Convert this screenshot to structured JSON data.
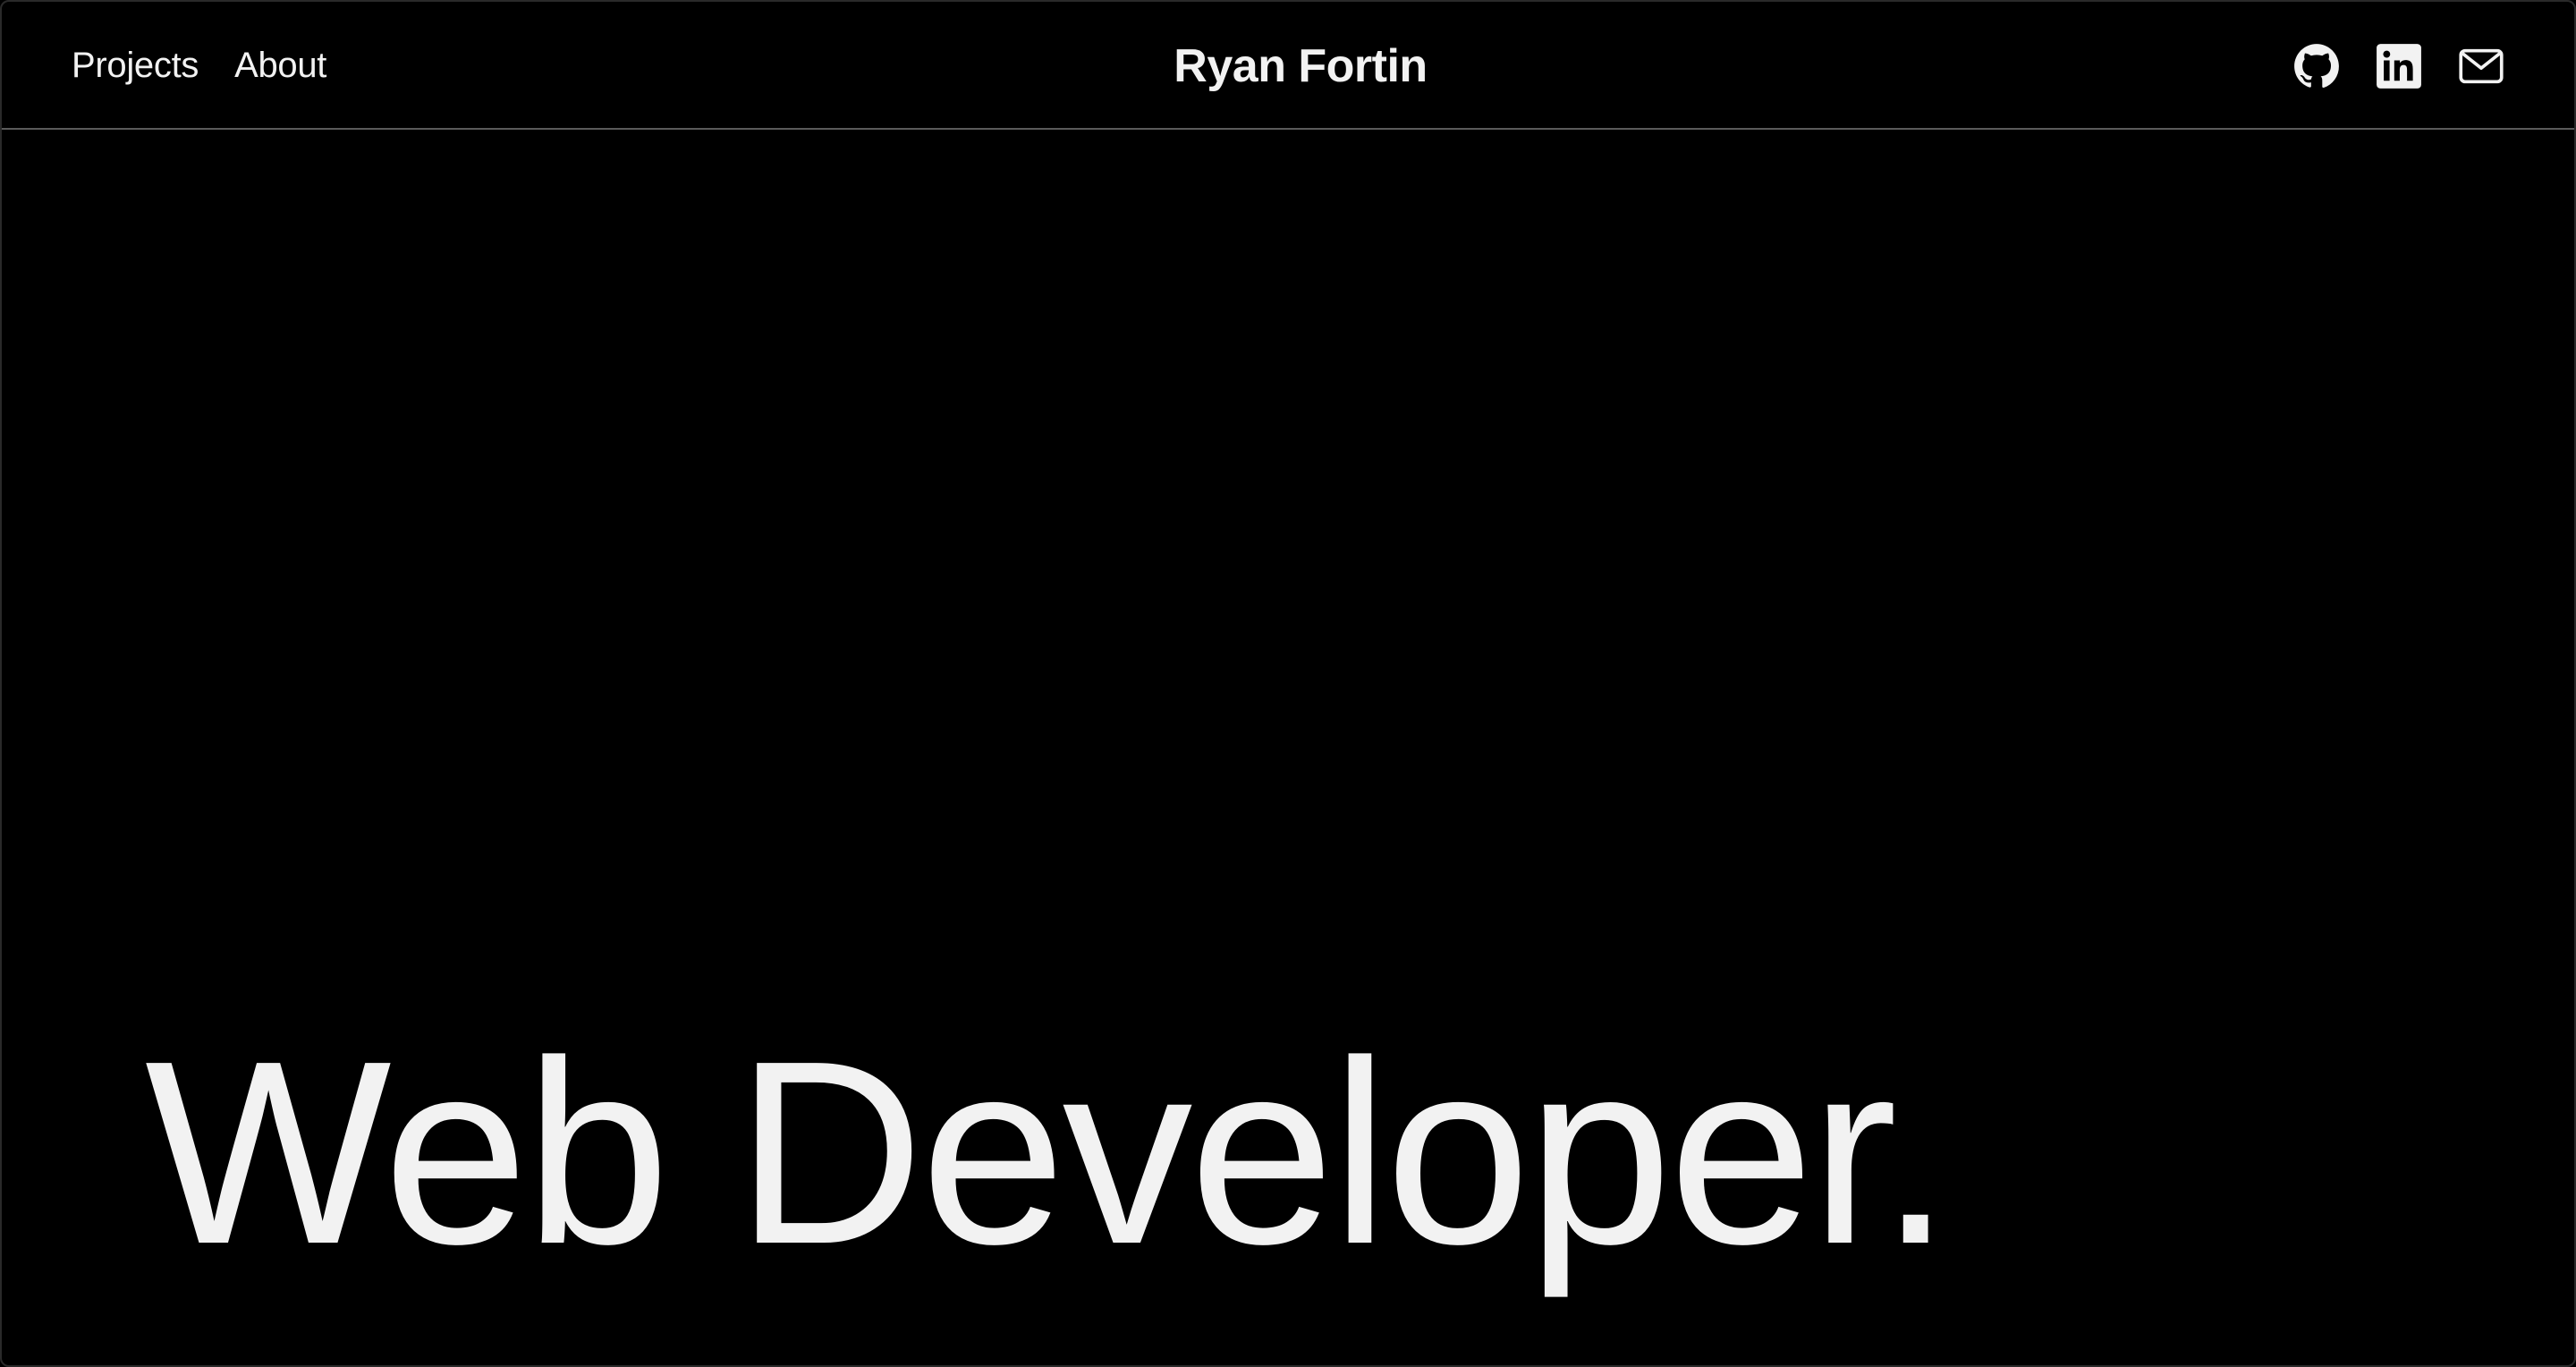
{
  "nav": {
    "links": [
      {
        "label": "Projects"
      },
      {
        "label": "About"
      }
    ],
    "site_title": "Ryan Fortin",
    "social_icons": [
      {
        "icon": "github-icon"
      },
      {
        "icon": "linkedin-icon"
      },
      {
        "icon": "mail-icon"
      }
    ]
  },
  "hero": {
    "headline": "Web Developer."
  },
  "colors": {
    "background": "#000000",
    "text": "#f2f2f2",
    "divider": "#5a5a5a"
  }
}
